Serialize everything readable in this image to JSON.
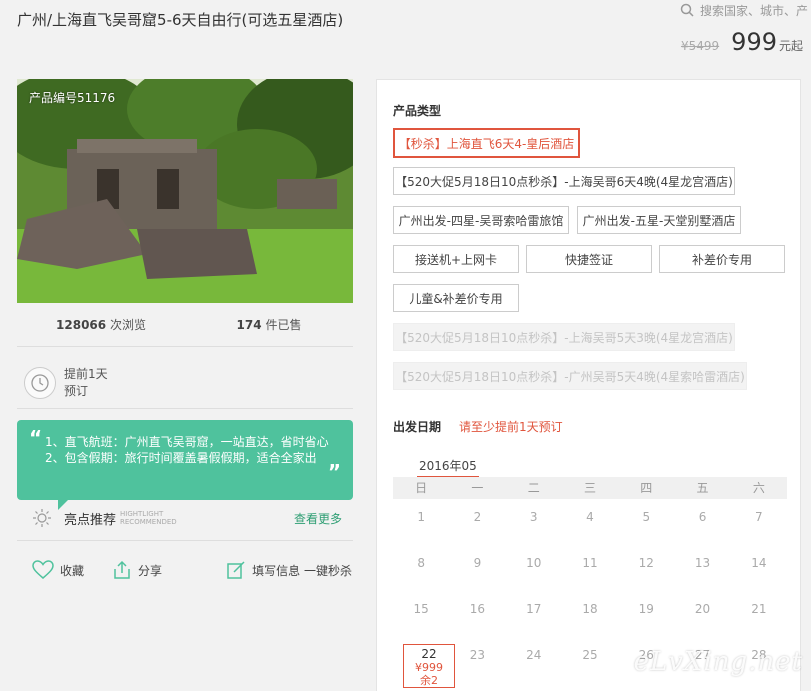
{
  "header": {
    "title": "广州/上海直飞吴哥窟5-6天自由行(可选五星酒店)",
    "search_placeholder": "搜索国家、城市、产",
    "price_old": "¥5499",
    "price_now": "999",
    "price_suffix": "元起"
  },
  "product": {
    "id_label": "产品编号51176",
    "views_count": "128066",
    "views_label": "次浏览",
    "sold_count": "174",
    "sold_label": "件已售",
    "advance_line1": "提前1天",
    "advance_line2": "预订"
  },
  "highlights": {
    "line1": "1、直飞航班：广州直飞吴哥窟，一站直达，省时省心",
    "line2": "2、包含假期：旅行时间覆盖暑假假期，适合全家出",
    "title": "亮点推荐",
    "subtitle_en1": "HIGHTLIGHT",
    "subtitle_en2": "RECOMMENDED",
    "more": "查看更多"
  },
  "actions": {
    "favorite": "收藏",
    "share": "分享",
    "fill_info": "填写信息 一键秒杀"
  },
  "panel": {
    "product_type_title": "产品类型",
    "options": [
      "【秒杀】上海直飞6天4-皇后酒店",
      "【520大促5月18日10点秒杀】-上海吴哥6天4晚(4星龙宫酒店)",
      "广州出发-四星-吴哥索哈雷旅馆",
      "广州出发-五星-天堂别墅酒店",
      "接送机+上网卡",
      "快捷签证",
      "补差价专用",
      "儿童&补差价专用",
      "【520大促5月18日10点秒杀】-上海吴哥5天3晚(4星龙宫酒店)",
      "【520大促5月18日10点秒杀】-广州吴哥5天4晚(4星索哈雷酒店)"
    ],
    "date_title": "出发日期",
    "date_hint": "请至少提前1天预订",
    "month": "2016年05",
    "weekdays": [
      "日",
      "一",
      "二",
      "三",
      "四",
      "五",
      "六"
    ],
    "rows": [
      [
        "1",
        "2",
        "3",
        "4",
        "5",
        "6",
        "7"
      ],
      [
        "8",
        "9",
        "10",
        "11",
        "12",
        "13",
        "14"
      ],
      [
        "15",
        "16",
        "17",
        "18",
        "19",
        "20",
        "21"
      ],
      [
        "",
        "23",
        "24",
        "25",
        "26",
        "27",
        "28"
      ]
    ],
    "selected_day": "22",
    "selected_price": "¥999",
    "selected_stock": "余2"
  },
  "watermark": "eLvXing.net",
  "colors": {
    "accent": "#e0553d",
    "brand_green": "#4fc29d"
  }
}
